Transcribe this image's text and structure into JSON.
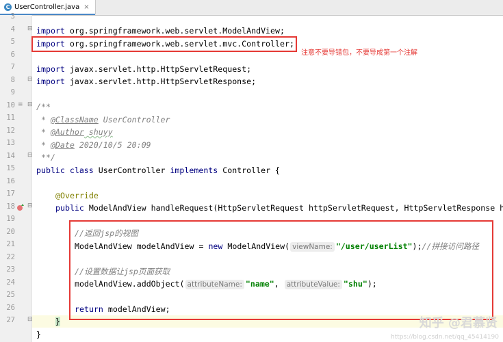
{
  "tab": {
    "label": "UserController.java",
    "close": "×"
  },
  "note": "注意不要导错包，不要导成第一个注解",
  "watermark": {
    "main": "知乎 @君慕贤",
    "url": "https://blog.csdn.net/qq_45414190"
  },
  "line_numbers": [
    "3",
    "4",
    "5",
    "6",
    "7",
    "8",
    "9",
    "10",
    "11",
    "12",
    "13",
    "14",
    "15",
    "16",
    "17",
    "18",
    "19",
    "20",
    "21",
    "22",
    "23",
    "24",
    "25",
    "26",
    "27"
  ],
  "code": {
    "l3_kw": "import",
    "l3_rest": " org.springframework.web.servlet.ModelAndView;",
    "l4_kw": "import",
    "l4_rest": " org.springframework.web.servlet.mvc.Controller;",
    "l6_kw": "import",
    "l6_rest": " javax.servlet.http.HttpServletRequest;",
    "l7_kw": "import",
    "l7_rest": " javax.servlet.http.HttpServletResponse;",
    "l9": "/**",
    "l10_pre": " * ",
    "l10_tag": "@ClassName",
    "l10_val": " UserController",
    "l11_pre": " * ",
    "l11_tag": "@Author",
    "l11_val": " shuyy",
    "l12_pre": " * ",
    "l12_tag": "@Date",
    "l12_val": " 2020/10/5 20:09",
    "l13": " **/",
    "l14_kw1": "public class",
    "l14_mid": " UserController ",
    "l14_kw2": "implements",
    "l14_end": " Controller {",
    "l16": "@Override",
    "l17_kw": "public",
    "l17_rest": " ModelAndView handleRequest(HttpServletRequest httpServletRequest, HttpServletResponse h",
    "l19": "//返回jsp的视图",
    "l20_pre": "ModelAndView modelAndView = ",
    "l20_kw": "new",
    "l20_mid": " ModelAndView(",
    "l20_hint": "viewName:",
    "l20_str": "\"/user/userList\"",
    "l20_end": ");",
    "l20_cmt": "//拼接访问路径",
    "l22": "//设置数据让jsp页面获取",
    "l23_pre": "modelAndView.addObject(",
    "l23_hint1": "attributeName:",
    "l23_str1": "\"name\"",
    "l23_sep": ", ",
    "l23_hint2": "attributeValue:",
    "l23_str2": "\"shu\"",
    "l23_end": ");",
    "l25_kw": "return",
    "l25_rest": " modelAndView;",
    "l26": "}",
    "l27": "}"
  },
  "colors": {
    "keyword": "#000080",
    "comment": "#808080",
    "string": "#008000",
    "annotation": "#808000",
    "highlight_box": "#e53935"
  }
}
